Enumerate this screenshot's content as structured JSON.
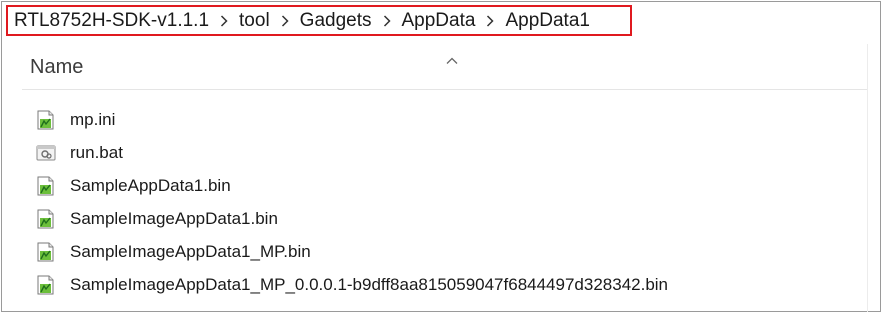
{
  "breadcrumb": {
    "items": [
      "RTL8752H-SDK-v1.1.1",
      "tool",
      "Gadgets",
      "AppData",
      "AppData1"
    ],
    "separator_icon": "chevron-right-icon",
    "highlight_color": "#e0191f"
  },
  "column_header": {
    "name_label": "Name",
    "sort_icon": "chevron-up-icon"
  },
  "files": [
    {
      "name": "mp.ini",
      "icon": "config-file-icon"
    },
    {
      "name": "run.bat",
      "icon": "batch-file-icon"
    },
    {
      "name": "SampleAppData1.bin",
      "icon": "config-file-icon"
    },
    {
      "name": "SampleImageAppData1.bin",
      "icon": "config-file-icon"
    },
    {
      "name": "SampleImageAppData1_MP.bin",
      "icon": "config-file-icon"
    },
    {
      "name": "SampleImageAppData1_MP_0.0.0.1-b9dff8aa815059047f6844497d328342.bin",
      "icon": "config-file-icon"
    }
  ]
}
